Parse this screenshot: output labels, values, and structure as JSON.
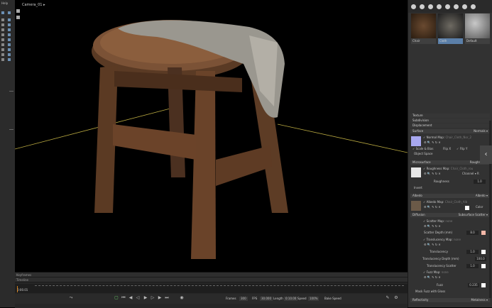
{
  "left_toolbar": {
    "menu": "Help"
  },
  "viewport": {
    "camera": "Camera_01 ▸"
  },
  "timeline": {
    "keyframes_label": "Keyframes",
    "timeline_label": "Timeline",
    "current_time": "0:00.01",
    "frames_label": "Frames",
    "frames_value": "300",
    "fps_label": "FPS",
    "fps_value": "30.000",
    "length_label": "Length",
    "length_value": "0:10.00",
    "speed_label": "Speed",
    "speed_value": "100%",
    "bake_label": "Bake Speed"
  },
  "materials": [
    {
      "label": "Chair"
    },
    {
      "label": "Cloth"
    },
    {
      "label": "Default"
    }
  ],
  "panel": {
    "texture": "Texture",
    "subdivision": "Subdivision",
    "displacement": "Displacement",
    "surface": "Surface",
    "surface_mode": "Normals ▾",
    "normal_map": "✓ Normal Map:",
    "normal_map_file": "Chair_Cloth_Nor_2",
    "scale_bias": "✓ Scale & Bias",
    "flip_x": "Flip X",
    "flip_y": "✓ Flip Y",
    "object_space": "Object Space",
    "microsurface": "Microsurface",
    "microsurface_mode": "Roughness ▾",
    "roughness_map": "✓ Roughness Map:",
    "roughness_map_file": "Chair_Cloth_rou",
    "channel": "Channel ▾ R",
    "roughness": "Roughness",
    "roughness_value": "1.0",
    "invert": "Invert",
    "albedo": "Albedo",
    "albedo_mode": "Albedo ▾",
    "albedo_map": "✓ Albedo Map:",
    "albedo_map_file": "Chair_Cloth_Alb",
    "color": "Color",
    "diffusion": "Diffusion",
    "diffusion_mode": "Subsurface Scatter ▾",
    "scatter_map": "✓ Scatter Map:",
    "scatter_map_file": "none",
    "scatter_depth": "Scatter Depth (mm)",
    "scatter_depth_value": "8.0",
    "translucency_map": "✓ Translucency Map:",
    "translucency_map_file": "none",
    "translucency": "Translucency",
    "translucency_value": "1.0",
    "translucency_depth": "Translucency Depth (mm)",
    "translucency_depth_value": "100.0",
    "translucency_scatter": "Translucency Scatter",
    "translucency_scatter_value": "1.0",
    "fuzz_map": "✓ Fuzz Map:",
    "fuzz_map_file": "none",
    "fuzz": "Fuzz",
    "fuzz_value": "0.235",
    "mask_fuzz": "Mask Fuzz with Gloss",
    "reflectivity": "Reflectivity",
    "reflectivity_mode": "Metalness ▾"
  }
}
